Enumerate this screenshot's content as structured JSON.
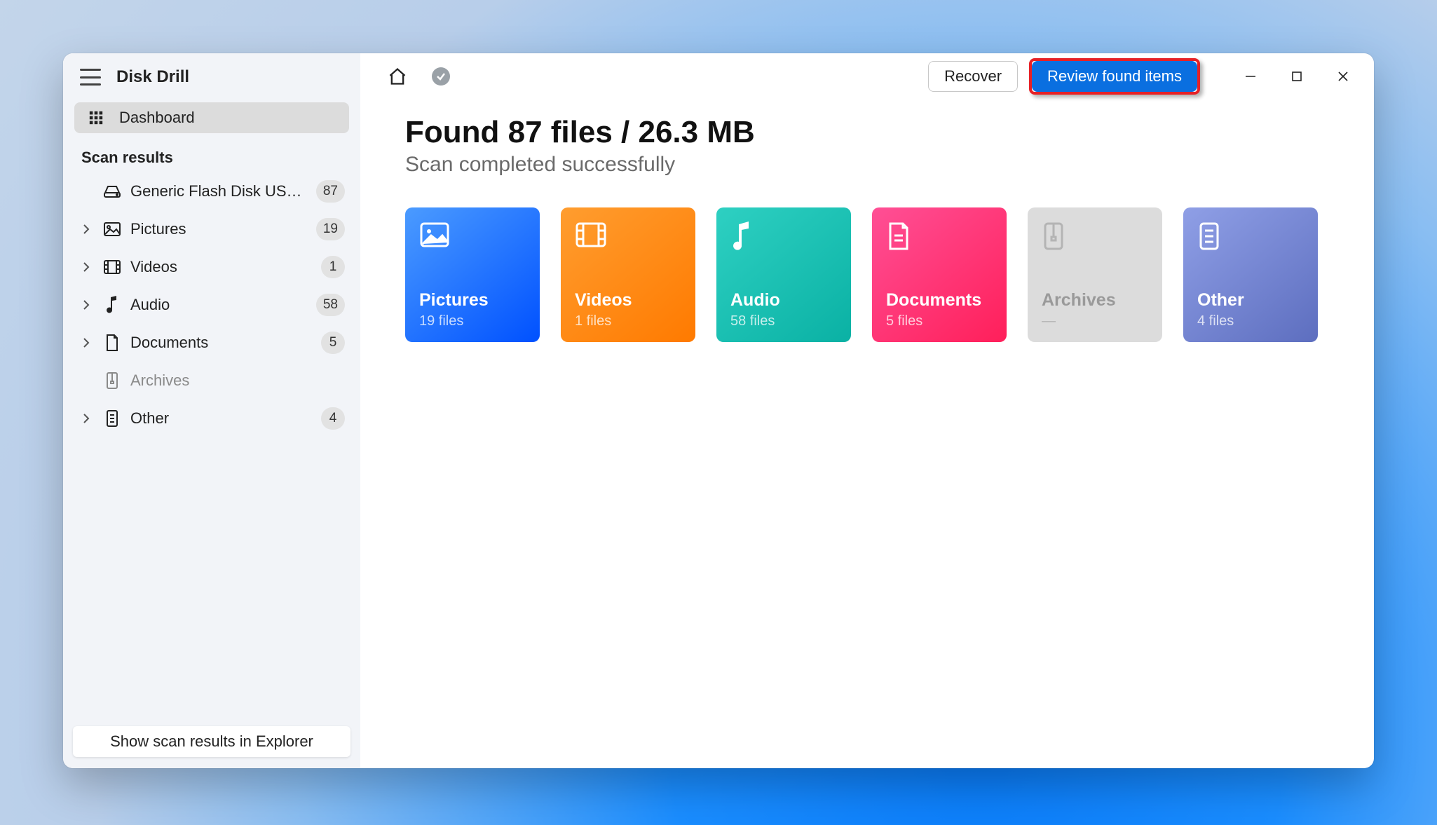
{
  "app": {
    "title": "Disk Drill"
  },
  "sidebar": {
    "dashboard_label": "Dashboard",
    "scan_results_label": "Scan results",
    "device_label": "Generic Flash Disk USB D…",
    "device_count": "87",
    "items": [
      {
        "label": "Pictures",
        "count": "19",
        "disabled": false
      },
      {
        "label": "Videos",
        "count": "1",
        "disabled": false
      },
      {
        "label": "Audio",
        "count": "58",
        "disabled": false
      },
      {
        "label": "Documents",
        "count": "5",
        "disabled": false
      },
      {
        "label": "Archives",
        "count": "",
        "disabled": true
      },
      {
        "label": "Other",
        "count": "4",
        "disabled": false
      }
    ],
    "footer_button": "Show scan results in Explorer"
  },
  "topbar": {
    "recover_label": "Recover",
    "review_label": "Review found items"
  },
  "results": {
    "headline": "Found 87 files / 26.3 MB",
    "subhead": "Scan completed successfully"
  },
  "cards": {
    "pictures": {
      "title": "Pictures",
      "sub": "19 files"
    },
    "videos": {
      "title": "Videos",
      "sub": "1 files"
    },
    "audio": {
      "title": "Audio",
      "sub": "58 files"
    },
    "documents": {
      "title": "Documents",
      "sub": "5 files"
    },
    "archives": {
      "title": "Archives",
      "sub": "—"
    },
    "other": {
      "title": "Other",
      "sub": "4 files"
    }
  }
}
